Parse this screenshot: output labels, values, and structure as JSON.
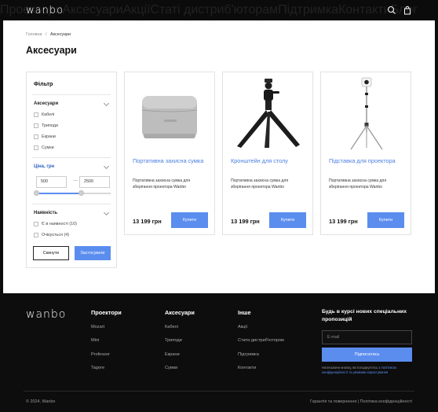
{
  "header": {
    "logo": "wanbo",
    "nav": [
      "Проектори",
      "Аксесуари",
      "Акції",
      "Статі дистриб'юторам",
      "Підтримка",
      "Контакти",
      "Блог"
    ]
  },
  "breadcrumb": {
    "home": "Головна",
    "sep": "/",
    "current": "Аксесуари"
  },
  "page_title": "Аксесуари",
  "filter": {
    "title": "Фільтр",
    "category": {
      "title": "Аксесуари",
      "options": [
        "Кабелі",
        "Триподи",
        "Екрани",
        "Сумки"
      ]
    },
    "price": {
      "title": "Ціна, грн",
      "min": "500",
      "max": "2500",
      "range_fraction": [
        0.0,
        0.6
      ]
    },
    "availability": {
      "title": "Наявність",
      "options": [
        "Є в наявності (10)",
        "Очікується (4)"
      ]
    },
    "reset_label": "Скинути",
    "apply_label": "Застосувати"
  },
  "products": [
    {
      "name": "Портативна захисна сумка",
      "desc": "Портативна захисна сумка для зберігання проектора Wanbo",
      "price": "13 199 грн",
      "buy": "Купити",
      "image_icon": "bag-icon"
    },
    {
      "name": "Кронштейн для столу",
      "desc": "Портативна захисна сумка для зберігання проектора Wanbo",
      "price": "13 199 грн",
      "buy": "Купити",
      "image_icon": "tripod-icon"
    },
    {
      "name": "Підставка для проектора",
      "desc": "Портативна захисна сумка для зберігання проектора Wanbo",
      "price": "13 199 грн",
      "buy": "Купити",
      "image_icon": "stand-icon"
    }
  ],
  "footer": {
    "logo": "wanbo",
    "columns": [
      {
        "title": "Проектори",
        "links": [
          "Mozart",
          "Mini",
          "Professor",
          "Tagore"
        ]
      },
      {
        "title": "Аксесуари",
        "links": [
          "Кабелі",
          "Триподи",
          "Екрани",
          "Сумки"
        ]
      },
      {
        "title": "Інше",
        "links": [
          "Акції",
          "Стати дистриб'ютором",
          "Підтримка",
          "Контакти"
        ]
      }
    ],
    "newsletter": {
      "title": "Будь в курсі нових спеціальних пропозицій",
      "email_placeholder": "E-mail",
      "button": "Підписатись",
      "consent_text": "Натискаючи кнопку, ви погоджуєтесь з ",
      "consent_link": "політикою конфіденційності та умовами користування"
    },
    "copyright": "© 2024, Wanbo",
    "legal": "Гарантія та повернення | Політика конфіденційності"
  },
  "colors": {
    "accent": "#5b8def",
    "dark": "#0d0d0d"
  }
}
